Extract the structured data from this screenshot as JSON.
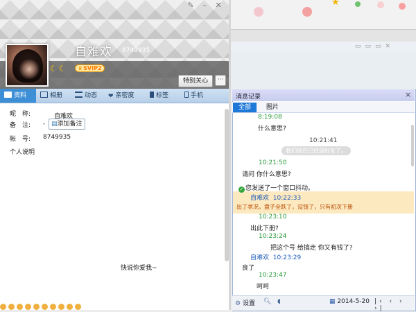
{
  "profile": {
    "nickname": "自难欢",
    "qq_number": "8749935",
    "vip_badge": "SVIP2",
    "care_button": "特别关心",
    "more_button": "···"
  },
  "tabs": [
    {
      "label": "资料"
    },
    {
      "label": "相册"
    },
    {
      "label": "动态"
    },
    {
      "label": "亲密度"
    },
    {
      "label": "标签"
    },
    {
      "label": "手机"
    }
  ],
  "info": {
    "nick_label": "昵　称:",
    "nick_value": "自难欢",
    "remark_label": "备　注:",
    "remark_dash": "-",
    "remark_link": "添加备注",
    "account_label": "帐　号:",
    "account_value": "8749935",
    "bio_label": "个人说明",
    "bio_text": "快说你爱我~"
  },
  "history": {
    "title": "消息记录",
    "tab_all": "全部",
    "tab_pics": "图片",
    "messages": [
      {
        "time": "8:19:08",
        "text": "什么意思?"
      },
      {
        "time": "10:21:41",
        "system": "我们现在已经是好友了。"
      },
      {
        "time": "10:21:50",
        "text": "请问 你什么意思?"
      },
      {
        "shake_note": "您发送了一个窗口抖动。"
      },
      {
        "sender": "自难欢",
        "time": "10:22:33",
        "text": "出了状况，盘子全跌了，没钱了，只有初次下册"
      },
      {
        "time": "10:23:10",
        "text": "出此下册?"
      },
      {
        "time": "10:23:24",
        "text": "把这个号 给搞走 你又有钱了?"
      },
      {
        "sender": "自难欢",
        "time": "10:23:29",
        "text": "良了"
      },
      {
        "time": "10:23:47",
        "text": "呵呵"
      }
    ],
    "footer": {
      "settings": "设置",
      "date": "2014-5-20"
    }
  },
  "colors": {
    "tab_active": "#3d8fd6",
    "time_self": "#2a9a3a",
    "time_friend": "#1a5ab8",
    "highlight": "#fde9c0"
  }
}
